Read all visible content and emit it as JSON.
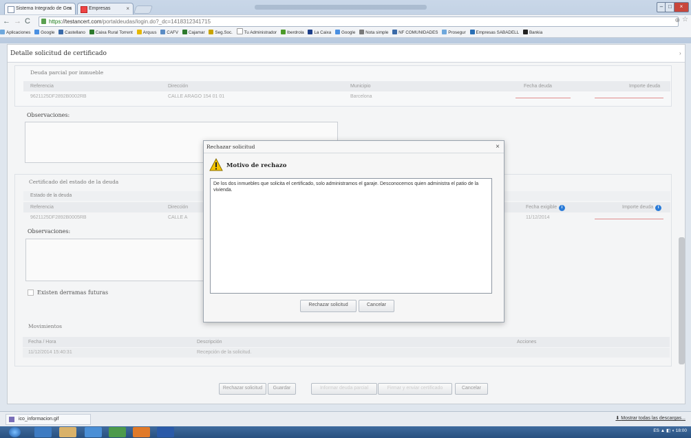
{
  "browser": {
    "tabs": [
      {
        "label": "Sistema Integrado de Ges"
      },
      {
        "label": "Empresas"
      }
    ],
    "url_https": "https",
    "url_host": "://testancert.com",
    "url_path": "/portaldeudas/login.do?_dc=1418312341715",
    "bookmarks": [
      "Aplicaciones",
      "Google",
      "Castellano",
      "Caixa Rural Torrent",
      "Arquus",
      "CAFV",
      "Cajamar",
      "Seg.Soc.",
      "Tu Administrador",
      "Iberdrola",
      "La Caixa",
      "Google",
      "Nota simple",
      "NF COMUNIDADES",
      "Prosegur",
      "Empresas SABADELL",
      "Bankia"
    ]
  },
  "page": {
    "header_title": "Detalle solicitud de certificado",
    "partial_debt": {
      "title": "Deuda parcial por inmueble",
      "columns": [
        "Referencia",
        "Dirección",
        "Municipio",
        "Fecha deuda",
        "Importe deuda"
      ],
      "rows": [
        [
          "9621125DF2892B0002RB",
          "CALLE ARAGO 154 01 01",
          "Barcelona",
          "",
          ""
        ]
      ]
    },
    "observations_label_1": "Observaciones:",
    "certificate_title": "Certificado del estado de la deuda",
    "debt_state": {
      "title": "Estado de la deuda",
      "columns": [
        "Referencia",
        "Dirección",
        "Fecha exigible",
        "Importe deuda"
      ],
      "rows": [
        [
          "9621125DF2892B0005RB",
          "CALLE A",
          "11/12/2014",
          ""
        ]
      ]
    },
    "observations_label_2": "Observaciones:",
    "future_spills_label": "Existen derramas futuras",
    "movements": {
      "title": "Movimientos",
      "columns": [
        "Fecha / Hora",
        "Descripción",
        "Acciones"
      ],
      "rows": [
        [
          "11/12/2014 15:40:31",
          "Recepción de la solicitud.",
          ""
        ]
      ]
    },
    "buttons": [
      "Rechazar solicitud",
      "Guardar",
      "Informar deuda parcial",
      "Firmar y enviar certificado",
      "Cancelar"
    ]
  },
  "modal": {
    "title": "Rechazar solicitud",
    "close_glyph": "×",
    "heading": "Motivo de rechazo",
    "reason": "De los dos inmuebles que solicita el certificado, solo administramos el garaje. Desconocemos quien administra el patio de la vivienda.",
    "reject_label": "Rechazar solicitud",
    "cancel_label": "Cancelar"
  },
  "download_bar": {
    "file": "ico_informacion.gif",
    "show_all": "Mostrar todas las descargas..."
  },
  "taskbar": {
    "lang": "ES",
    "time": "18:00"
  }
}
